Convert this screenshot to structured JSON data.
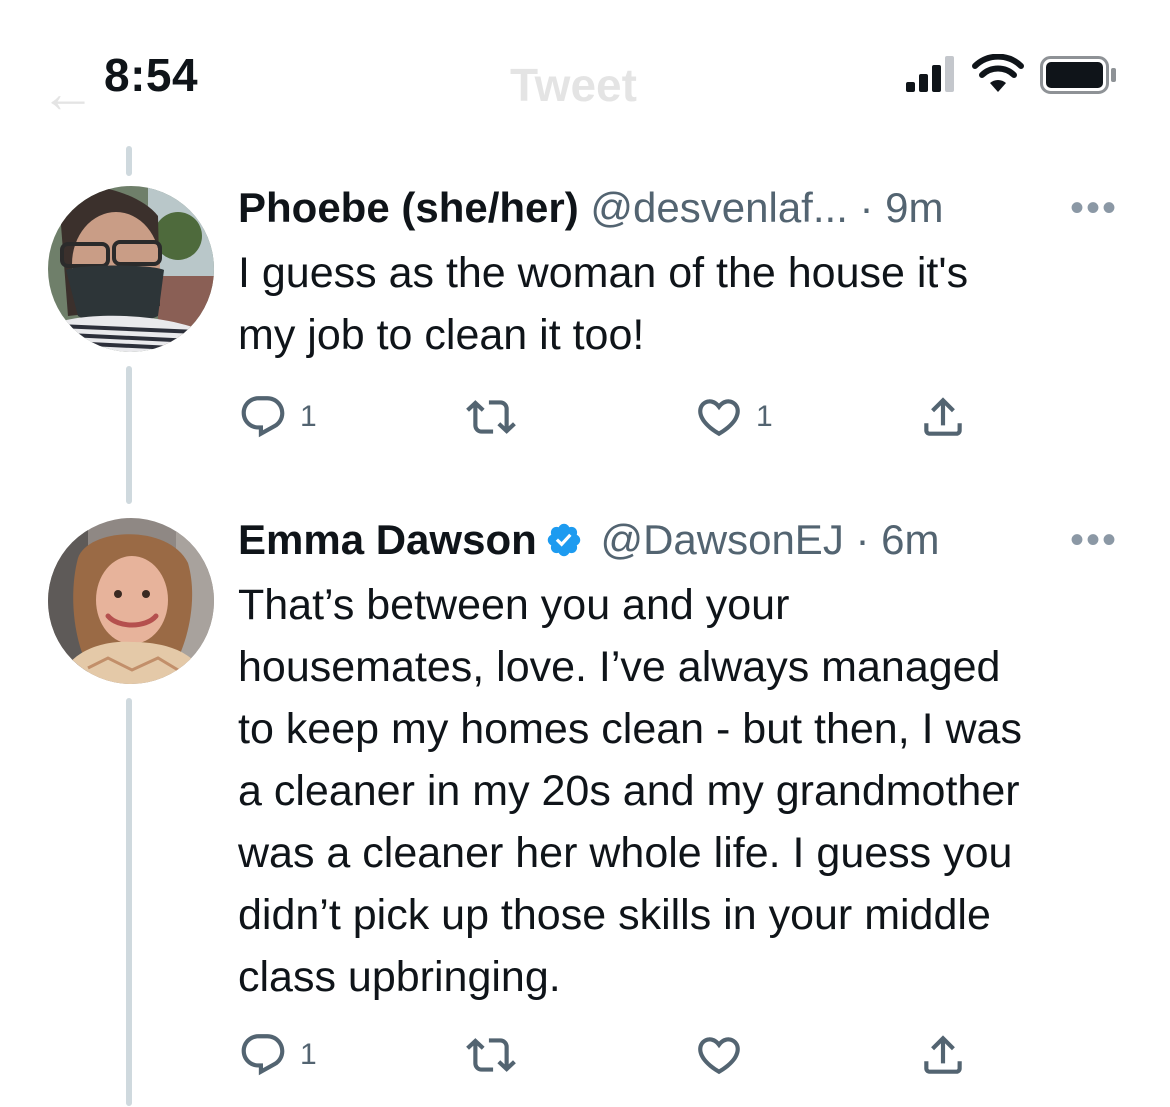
{
  "status_bar": {
    "time": "8:54",
    "ghost_title": "Tweet"
  },
  "colors": {
    "text": "#0f1419",
    "secondary": "#536471",
    "verified": "#1d9bf0",
    "thread_line": "#cfd9de"
  },
  "tweets": [
    {
      "name": "Phoebe (she/her)",
      "handle": "@desvenlaf...",
      "time": "· 9m",
      "text": "I guess as the woman of the house it's\nmy job to clean it too!",
      "reply_count": "1",
      "retweet_count": "",
      "like_count": "1",
      "verified": false
    },
    {
      "name": "Emma Dawson",
      "handle": "@DawsonEJ",
      "time": "· 6m",
      "text": "That’s between you and your\nhousemates, love. I’ve always managed\nto keep my homes clean - but then, I was\na cleaner in my 20s and my grandmother\nwas a cleaner her whole life. I guess you\ndidn’t pick up those skills in your middle\nclass upbringing.",
      "reply_count": "1",
      "retweet_count": "",
      "like_count": "",
      "verified": true
    }
  ],
  "icons": {
    "more": "more-icon",
    "reply": "reply-icon",
    "retweet": "retweet-icon",
    "like": "heart-icon",
    "share": "share-icon",
    "verified": "verified-badge-icon"
  }
}
